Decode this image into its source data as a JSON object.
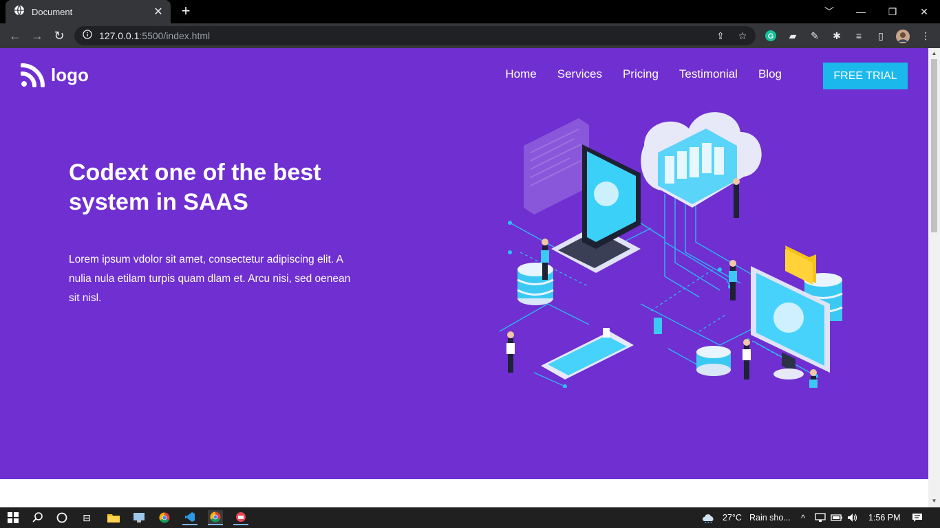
{
  "browser": {
    "tab_title": "Document",
    "tab_close": "✕",
    "new_tab": "+",
    "url_host": "127.0.0.1",
    "url_rest": ":5500/index.html",
    "window_controls": [
      "﹀",
      "—",
      "❐",
      "✕"
    ]
  },
  "site": {
    "logo_text": "logo",
    "nav": [
      "Home",
      "Services",
      "Pricing",
      "Testimonial",
      "Blog"
    ],
    "cta": "FREE TRIAL",
    "headline": "Codext one of the best system in SAAS",
    "lede": "Lorem ipsum vdolor sit amet, consectetur adipiscing elit. A nulia nula etilam turpis quam dlam et. Arcu nisi, sed oenean sit nisl.",
    "colors": {
      "hero_bg": "#6f2fd1",
      "cta_bg": "#1bb8ec",
      "text": "#ffffff"
    }
  },
  "taskbar": {
    "temperature": "27°C",
    "weather": "Rain sho...",
    "time": "1:56 PM"
  }
}
